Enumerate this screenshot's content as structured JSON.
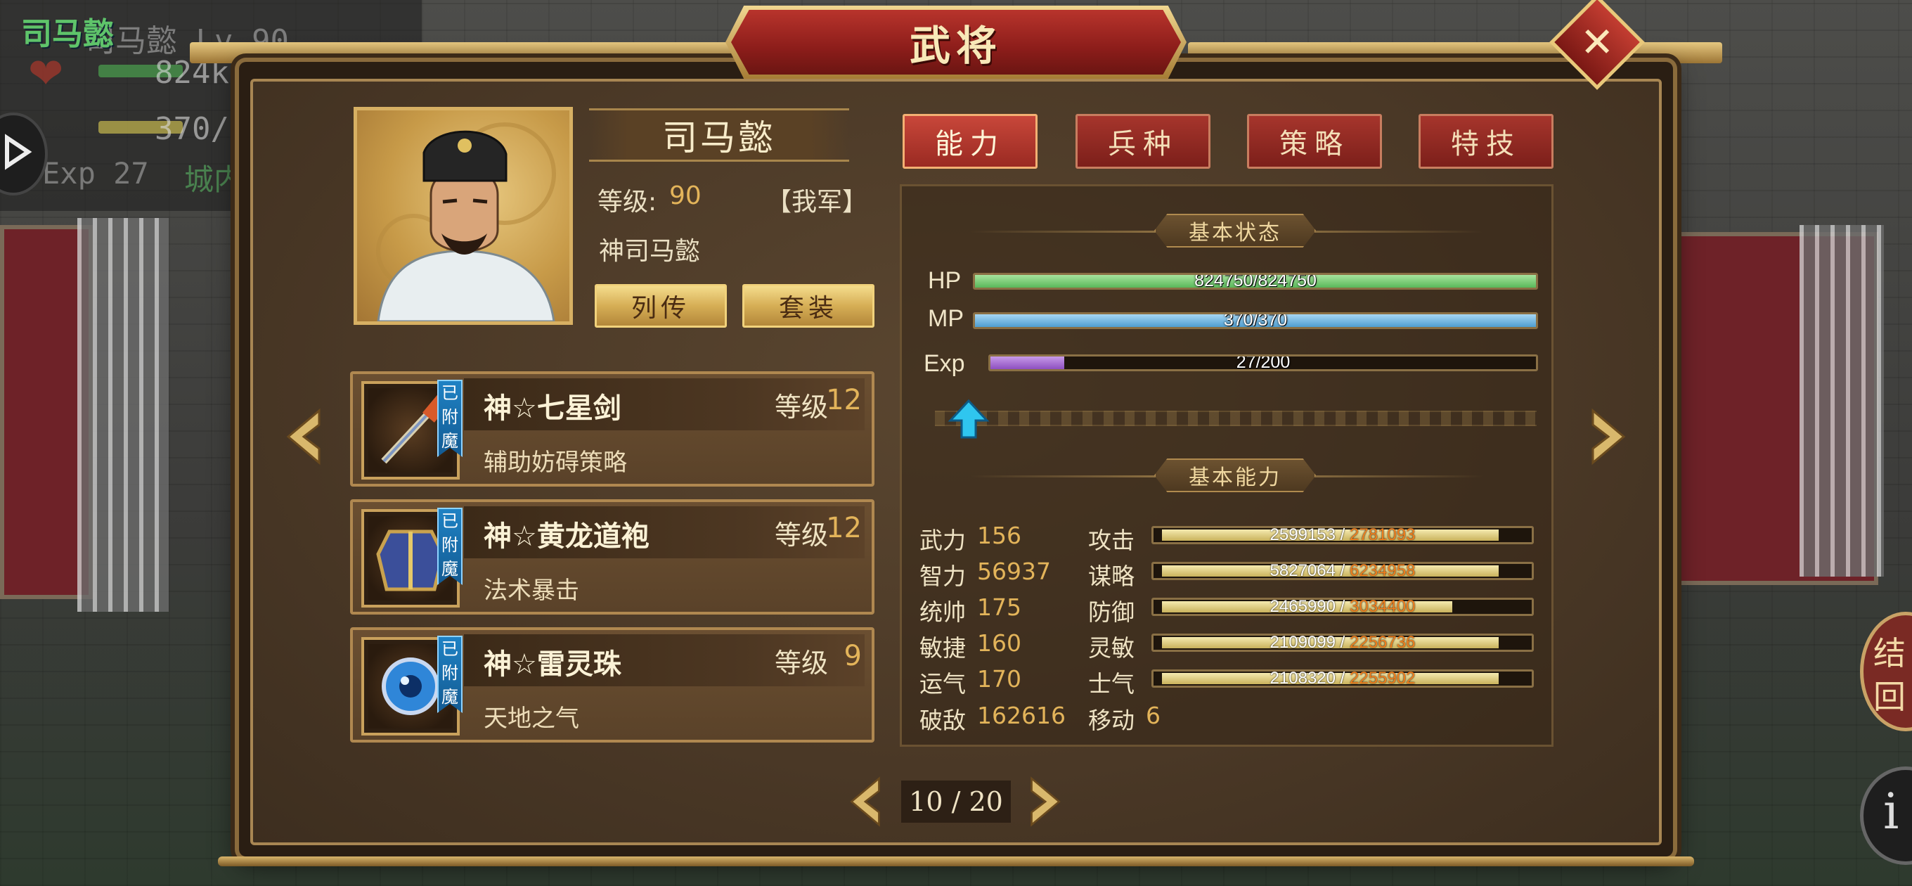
{
  "background": {
    "hud_name": "司马懿",
    "hud_level": "司马懿 Lv 90",
    "hud_hp": "824k",
    "hud_mp": "370/",
    "hud_exp": "Exp 27",
    "hud_city": "城内",
    "right_btn_char1": "结",
    "right_btn_char2": "回"
  },
  "dialog": {
    "title": "武将",
    "close_icon": "close-icon"
  },
  "general": {
    "name": "司马懿",
    "level_label": "等级:",
    "level": "90",
    "faction": "【我军】",
    "title": "神司马懿",
    "btn_biography": "列传",
    "btn_set": "套装"
  },
  "equipment": [
    {
      "name": "神☆七星剑",
      "level_label": "等级",
      "level": "12",
      "desc": "辅助妨碍策略",
      "badge": "已附魔",
      "icon": "sword-icon"
    },
    {
      "name": "神☆黄龙道袍",
      "level_label": "等级",
      "level": "12",
      "desc": "法术暴击",
      "badge": "已附魔",
      "icon": "robe-icon"
    },
    {
      "name": "神☆雷灵珠",
      "level_label": "等级",
      "level": "9",
      "desc": "天地之气",
      "badge": "已附魔",
      "icon": "orb-icon"
    }
  ],
  "tabs": [
    {
      "label": "能力",
      "active": true
    },
    {
      "label": "兵种",
      "active": false
    },
    {
      "label": "策略",
      "active": false
    },
    {
      "label": "特技",
      "active": false
    }
  ],
  "status": {
    "title": "基本状态",
    "hp": {
      "label": "HP",
      "text": "824750/824750",
      "ratio": 1.0
    },
    "mp": {
      "label": "MP",
      "text": "370/370",
      "ratio": 1.0
    },
    "exp": {
      "label": "Exp",
      "text": "27/200",
      "ratio": 0.135
    }
  },
  "abilities": {
    "title": "基本能力",
    "left": [
      {
        "label": "武力",
        "value": "156"
      },
      {
        "label": "智力",
        "value": "56937"
      },
      {
        "label": "统帅",
        "value": "175"
      },
      {
        "label": "敏捷",
        "value": "160"
      },
      {
        "label": "运气",
        "value": "170"
      },
      {
        "label": "破敌",
        "value": "162616"
      }
    ],
    "right": [
      {
        "label": "攻击",
        "cur": "2599153",
        "sep": " / ",
        "max": "2781093",
        "ratio": 0.935
      },
      {
        "label": "谋略",
        "cur": "5827064",
        "sep": " / ",
        "max": "6234958",
        "ratio": 0.935
      },
      {
        "label": "防御",
        "cur": "2465990",
        "sep": " / ",
        "max": "3034400",
        "ratio": 0.813
      },
      {
        "label": "灵敏",
        "cur": "2109099",
        "sep": " / ",
        "max": "2256736",
        "ratio": 0.935
      },
      {
        "label": "士气",
        "cur": "2108320",
        "sep": " / ",
        "max": "2255902",
        "ratio": 0.935
      }
    ],
    "move_label": "移动",
    "move_value": "6"
  },
  "pager": {
    "text": "10 / 20"
  },
  "colors": {
    "hp_bar": "#7fd27a",
    "mp_bar": "#6fb7e6",
    "exp_bar": "#a86ad2",
    "accent_gold": "#e3b45a",
    "tab_red": "#9a2a22"
  }
}
